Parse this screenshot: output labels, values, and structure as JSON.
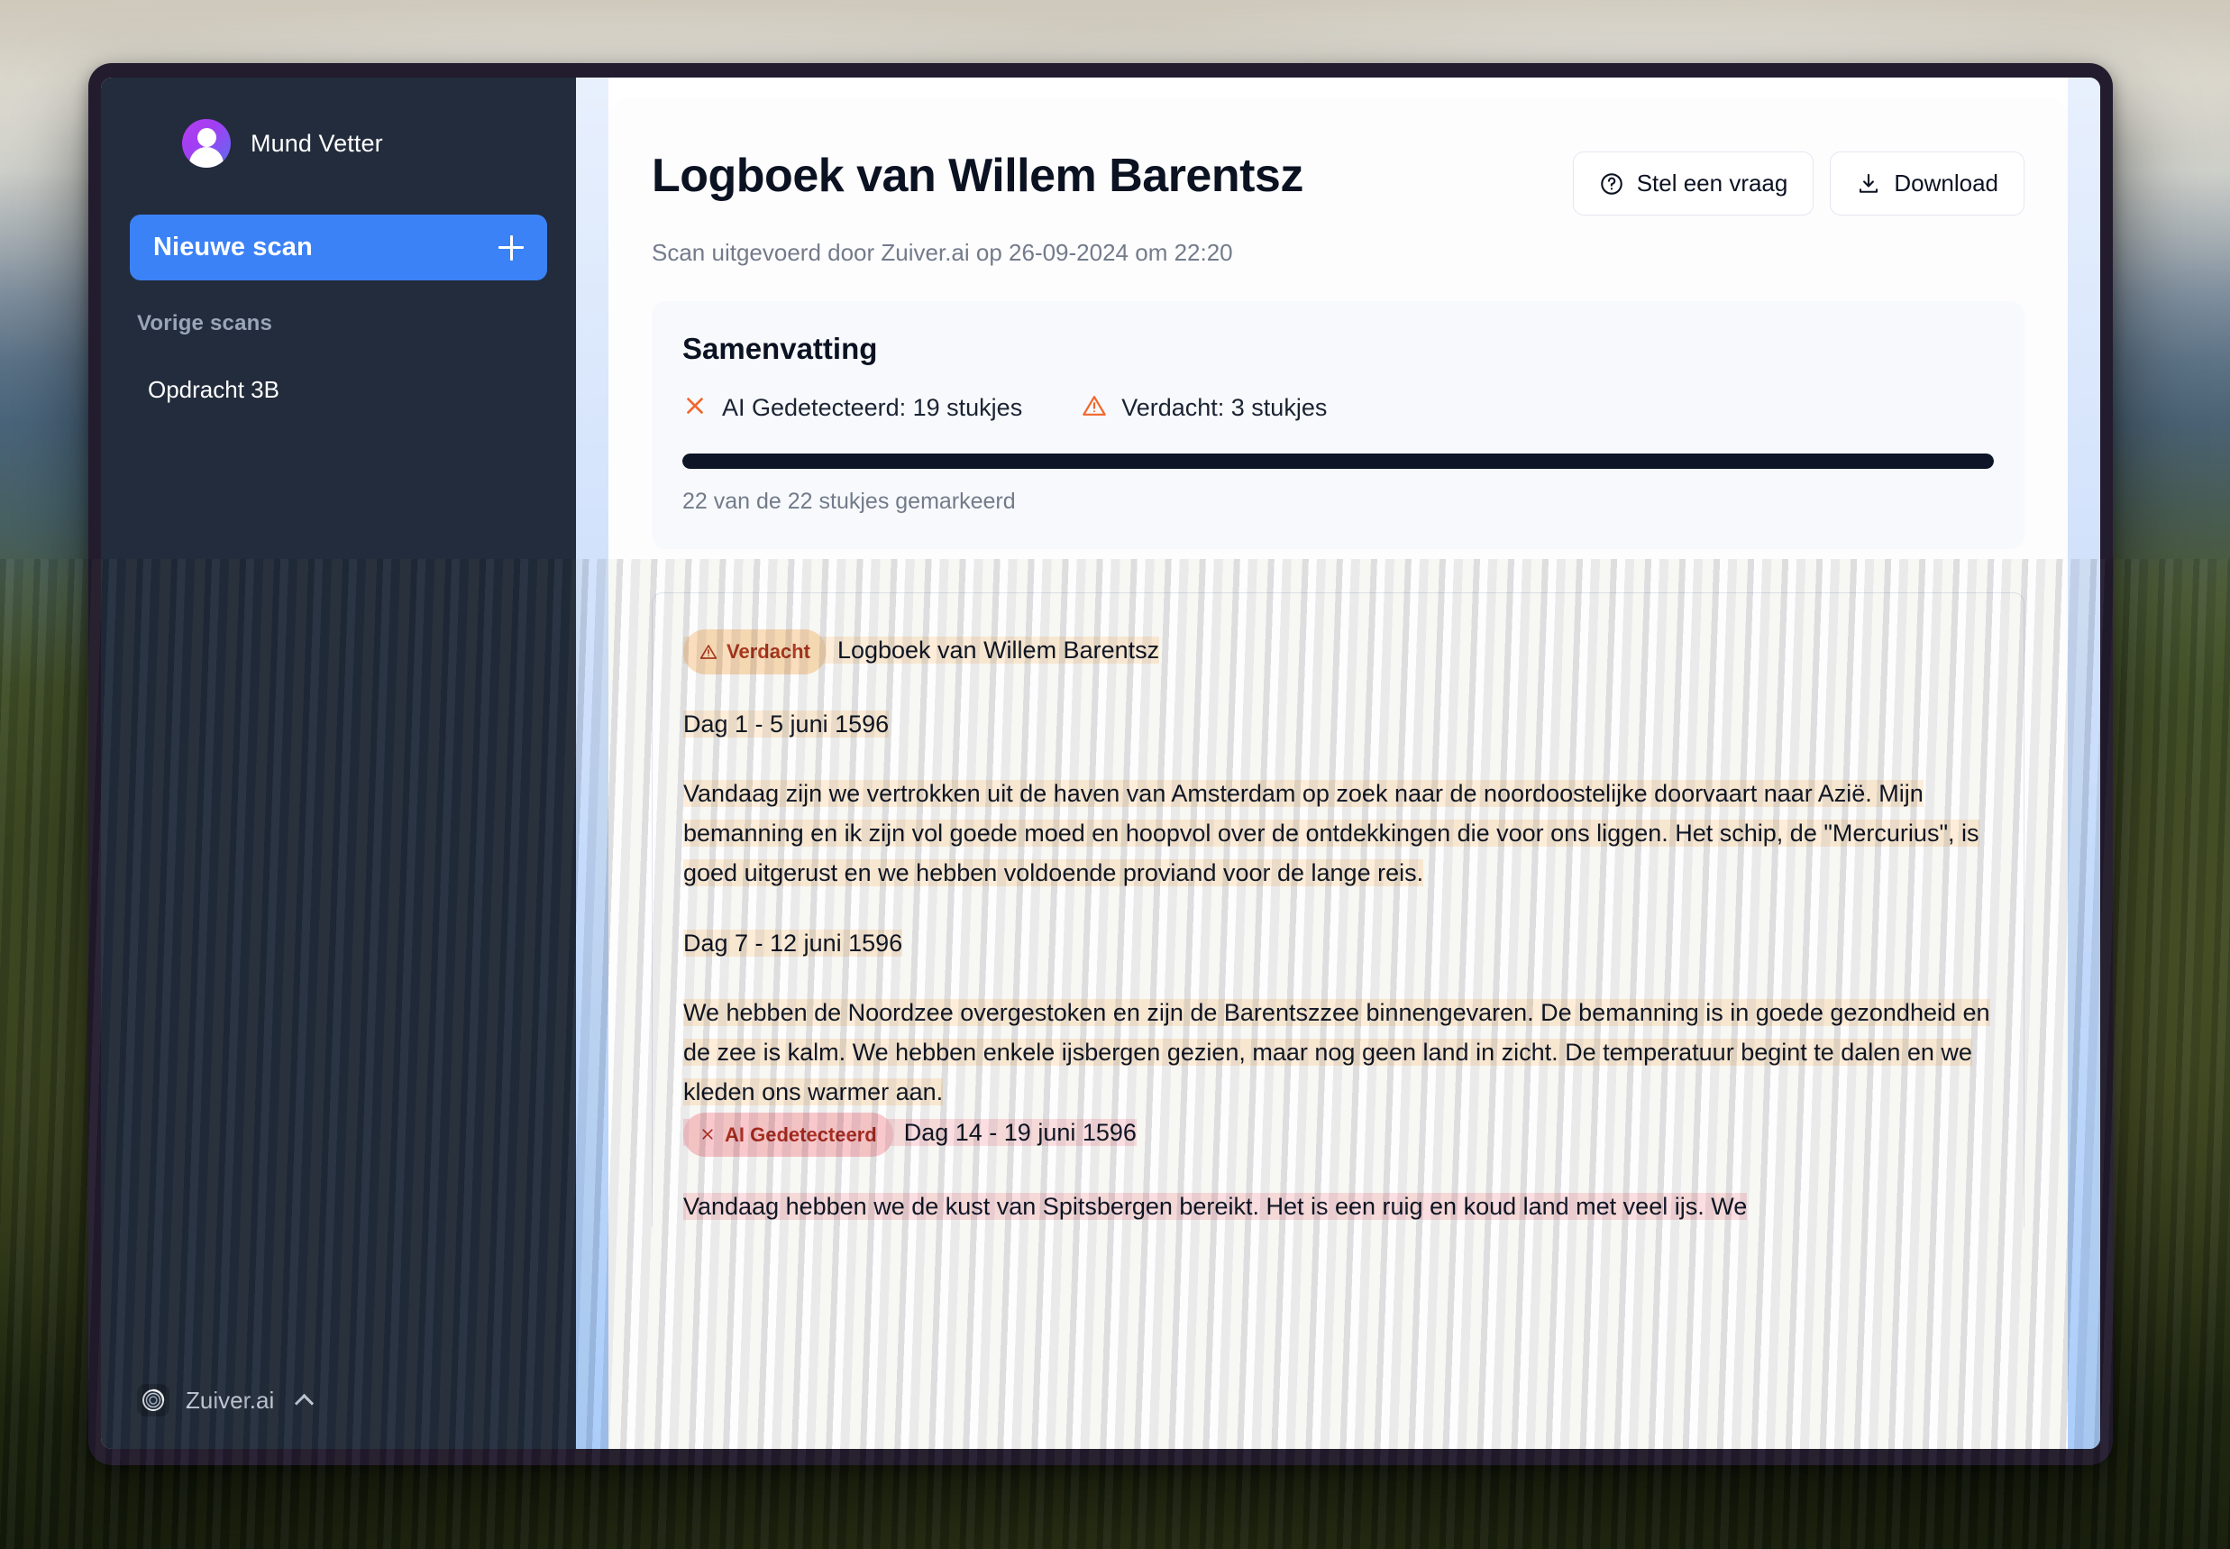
{
  "colors": {
    "accent_blue": "#3b82f6",
    "sidebar_bg": "#222c3c",
    "badge_suspect_bg": "#fadcb9",
    "badge_suspect_fg": "#a8341c",
    "badge_ai_bg": "#f9c6cb",
    "badge_ai_fg": "#a8281f",
    "highlight_suspect": "#fdecd8",
    "highlight_ai": "#fbdde0",
    "progress_fill": "#0d1526",
    "warning_orange": "#f2662b"
  },
  "sidebar": {
    "user": {
      "name": "Mund Vetter",
      "avatar_icon": "user-avatar-icon"
    },
    "new_scan": {
      "label": "Nieuwe scan",
      "icon": "plus-icon"
    },
    "section_label": "Vorige scans",
    "scans": [
      {
        "label": "Opdracht 3B"
      }
    ],
    "brand": {
      "name": "Zuiver.ai",
      "logo_icon": "zuiver-logo-icon",
      "chevron_icon": "chevron-up-icon"
    }
  },
  "document": {
    "title": "Logboek van Willem Barentsz",
    "subtitle": "Scan uitgevoerd door Zuiver.ai op 26-09-2024 om 22:20",
    "actions": [
      {
        "label": "Stel een vraag",
        "icon": "question-circle-icon"
      },
      {
        "label": "Download",
        "icon": "download-icon"
      }
    ]
  },
  "summary": {
    "title": "Samenvatting",
    "stats": [
      {
        "icon": "x-mark-icon",
        "text": "AI Gedetecteerd: 19 stukjes"
      },
      {
        "icon": "warning-triangle-icon",
        "text": "Verdacht: 3 stukjes"
      }
    ],
    "progress_percent": 100,
    "caption": "22 van de 22 stukjes gemarkeerd"
  },
  "content": {
    "badge_suspect_label": "Verdacht",
    "badge_ai_label": "AI Gedetecteerd",
    "heading_title": "Logboek van Willem Barentsz",
    "day1_heading": "Dag 1 - 5 juni 1596",
    "day1_text": "Vandaag zijn we vertrokken uit de haven van Amsterdam op zoek naar de noordoostelijke doorvaart naar Azië. Mijn bemanning en ik zijn vol goede moed en hoopvol over de ontdekkingen die voor ons liggen. Het schip, de \"Mercurius\", is goed uitgerust en we hebben voldoende proviand voor de lange reis.",
    "day7_heading": "Dag 7 - 12 juni 1596",
    "day7_text": "We hebben de Noordzee overgestoken en zijn de Barentszzee binnengevaren. De bemanning is in goede gezondheid en de zee is kalm. We hebben enkele ijsbergen gezien, maar nog geen land in zicht. De temperatuur begint te dalen en we kleden ons warmer aan.",
    "day14_heading": "Dag 14 - 19 juni 1596",
    "day14_text": "Vandaag hebben we de kust van Spitsbergen bereikt. Het is een ruig en koud land met veel ijs. We"
  }
}
